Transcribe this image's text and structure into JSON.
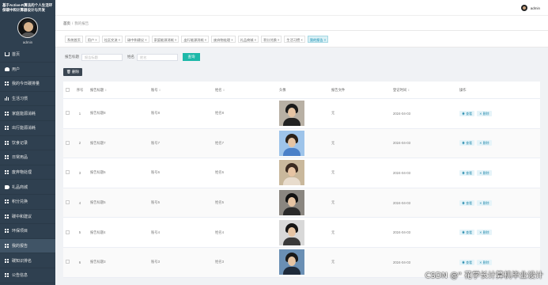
{
  "app": {
    "title": "基于Active-R算法的个人生活环保碳中和计算器设计与开发",
    "username": "admin"
  },
  "topbar": {
    "username": "admin"
  },
  "breadcrumb": {
    "home": "首页",
    "separator": "/",
    "current": "我的报告"
  },
  "sidebar": {
    "items": [
      {
        "label": "首页",
        "icon": "home-icon"
      },
      {
        "label": "用户",
        "icon": "user-icon"
      },
      {
        "label": "我的今日碳排量",
        "icon": "grid-icon"
      },
      {
        "label": "生活习惯",
        "icon": "bars-icon"
      },
      {
        "label": "家庭能源消耗",
        "icon": "grid-icon"
      },
      {
        "label": "出行能源消耗",
        "icon": "grid-icon"
      },
      {
        "label": "饮食记录",
        "icon": "grid-icon"
      },
      {
        "label": "日常用品",
        "icon": "grid-icon"
      },
      {
        "label": "废弃物处理",
        "icon": "grid-icon"
      },
      {
        "label": "礼品商城",
        "icon": "tag-icon"
      },
      {
        "label": "积分兑换",
        "icon": "grid-icon"
      },
      {
        "label": "碳中和建议",
        "icon": "grid-icon"
      },
      {
        "label": "环保项目",
        "icon": "grid-icon"
      },
      {
        "label": "我的报告",
        "icon": "grid-icon"
      },
      {
        "label": "碳知识排名",
        "icon": "grid-icon"
      },
      {
        "label": "公告信息",
        "icon": "grid-icon"
      }
    ],
    "active_index": 13
  },
  "tabs": [
    {
      "label": "系统首页"
    },
    {
      "label": "用户 ×"
    },
    {
      "label": "社区交流 ×"
    },
    {
      "label": "碳中和建议 ×"
    },
    {
      "label": "家庭能源消耗 ×"
    },
    {
      "label": "出行能源消耗 ×"
    },
    {
      "label": "废弃物处理 ×"
    },
    {
      "label": "礼品商城 ×"
    },
    {
      "label": "积分兑换 ×"
    },
    {
      "label": "生活习惯 ×"
    },
    {
      "label": "我的报告 ×"
    }
  ],
  "search": {
    "title_label": "报告标题",
    "title_placeholder": "报告标题",
    "name_label": "姓名",
    "name_placeholder": "姓名",
    "query_button": "查询"
  },
  "toolbar": {
    "delete_label": "删除"
  },
  "table": {
    "columns": {
      "index": "序号",
      "title": "报告标题",
      "account": "账号",
      "name": "姓名",
      "avatar": "头像",
      "file": "报告文件",
      "date": "登记时间",
      "ops": "操作"
    },
    "sort_glyph": "⇕",
    "view_label": "查看",
    "delete_label": "删除",
    "rows": [
      {
        "index": "1",
        "title": "报告标题8",
        "account": "账号8",
        "name": "姓名8",
        "file": "无",
        "date": "2024-04-03",
        "hair": "#1a1a1a",
        "body": "#222222",
        "bg": "#b8b0a4"
      },
      {
        "index": "2",
        "title": "报告标题7",
        "account": "账号7",
        "name": "姓名7",
        "file": "无",
        "date": "2024-04-03",
        "hair": "#2b2119",
        "body": "#4a80c8",
        "bg": "#9ec4ea"
      },
      {
        "index": "3",
        "title": "报告标题6",
        "account": "账号6",
        "name": "姓名6",
        "file": "无",
        "date": "2024-04-03",
        "hair": "#3a2a20",
        "body": "#e8dccd",
        "bg": "#c9b89c"
      },
      {
        "index": "4",
        "title": "报告标题5",
        "account": "账号5",
        "name": "姓名5",
        "file": "无",
        "date": "2024-04-03",
        "hair": "#111111",
        "body": "#2a2a2a",
        "bg": "#8a8680"
      },
      {
        "index": "5",
        "title": "报告标题4",
        "account": "账号4",
        "name": "姓名4",
        "file": "无",
        "date": "2024-04-03",
        "hair": "#151515",
        "body": "#3a3a3a",
        "bg": "#d8d8d8"
      },
      {
        "index": "6",
        "title": "报告标题3",
        "account": "账号3",
        "name": "姓名3",
        "file": "无",
        "date": "2024-04-03",
        "hair": "#1a1a1a",
        "body": "#1e2a3a",
        "bg": "#6a8fb4"
      }
    ]
  },
  "watermark": "CSDN @\" 花学长计算机毕业设计"
}
